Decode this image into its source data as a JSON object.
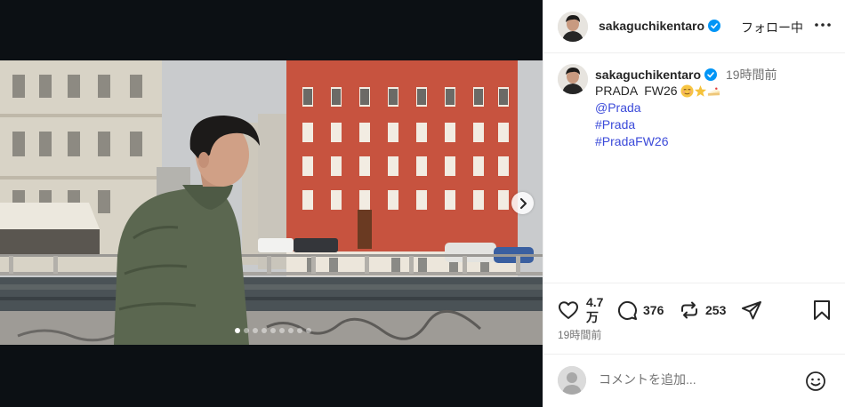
{
  "post": {
    "username": "sakaguchikentaro",
    "follow_status": "フォロー中",
    "time_ago": "19時間前",
    "caption_text": "PRADA  FW26",
    "caption_emoji": [
      "relieved-face",
      "star",
      "cake-slice"
    ],
    "mention": "@Prada",
    "hashtags": [
      "#Prada",
      "#PradaFW26"
    ],
    "post_time": "19時間前"
  },
  "actions": {
    "likes": "4.7 万",
    "comments": "376",
    "reposts": "253"
  },
  "carousel": {
    "total_slides": 9,
    "active_index": 0
  },
  "comment_box": {
    "placeholder": "コメントを追加..."
  },
  "icons": {
    "verified": "verified-badge-icon",
    "more": "more-horizontal-icon",
    "like": "heart-icon",
    "comment": "comment-bubble-icon",
    "repost": "repost-icon",
    "share": "send-icon",
    "save": "bookmark-icon",
    "next": "chevron-right-icon",
    "emoji": "smiley-icon"
  },
  "colors": {
    "link": "#3b4ad9",
    "verified": "#0095f6",
    "muted": "#737373"
  }
}
